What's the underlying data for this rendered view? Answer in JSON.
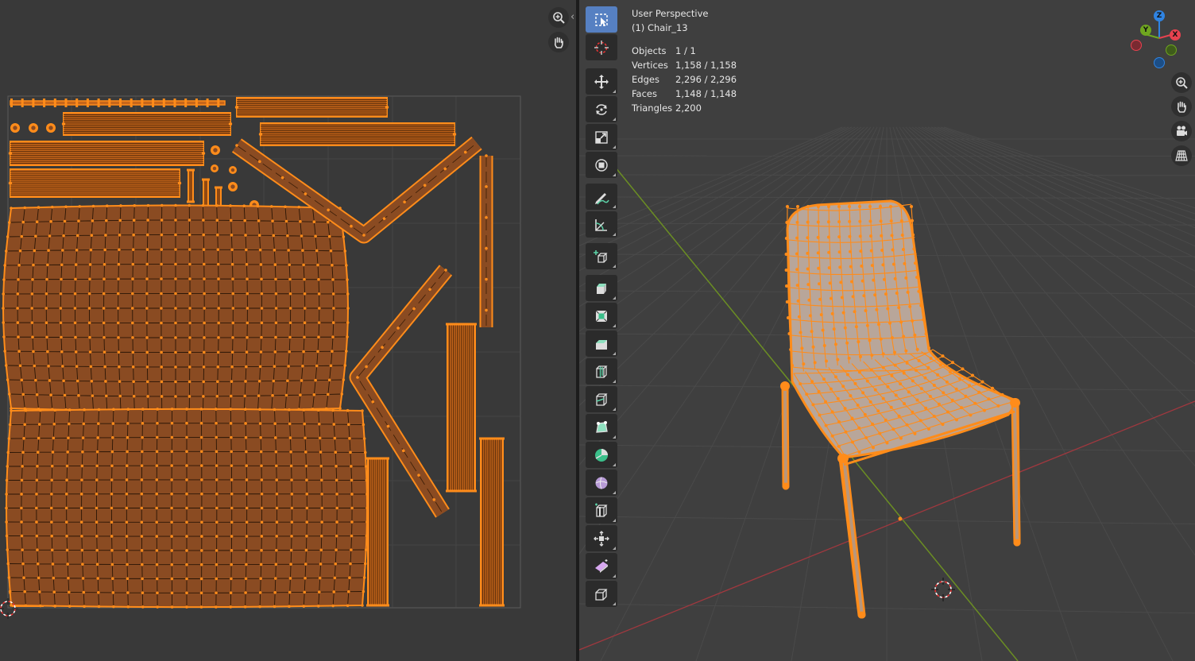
{
  "uv_editor": {
    "nav_buttons": [
      {
        "name": "zoom",
        "icon": "zoom-in-icon"
      },
      {
        "name": "pan",
        "icon": "hand-icon"
      }
    ],
    "collapse_glyph": "‹",
    "island_color": "#8a4b22",
    "edge_color": "#ff8c1a"
  },
  "viewport": {
    "header": {
      "view_name": "User Perspective",
      "object_name": "(1) Chair_13"
    },
    "stats": [
      {
        "label": "Objects",
        "value": "1 / 1"
      },
      {
        "label": "Vertices",
        "value": "1,158 / 1,158"
      },
      {
        "label": "Edges",
        "value": "2,296 / 2,296"
      },
      {
        "label": "Faces",
        "value": "1,148 / 1,148"
      },
      {
        "label": "Triangles",
        "value": "2,200"
      }
    ],
    "gizmo": {
      "x": "X",
      "y": "Y",
      "z": "Z",
      "x_color": "#e8424f",
      "y_color": "#6fa61f",
      "z_color": "#2f84e3"
    },
    "tools": [
      {
        "name": "select-box",
        "icon": "select-box-icon",
        "active": true
      },
      {
        "name": "cursor",
        "icon": "cursor-icon"
      },
      {
        "name": "move",
        "icon": "move-icon"
      },
      {
        "name": "rotate",
        "icon": "rotate-icon"
      },
      {
        "name": "scale",
        "icon": "scale-icon"
      },
      {
        "name": "transform",
        "icon": "transform-icon"
      },
      {
        "name": "annotate",
        "icon": "annotate-icon"
      },
      {
        "name": "measure",
        "icon": "measure-icon"
      },
      {
        "name": "add-cube",
        "icon": "add-cube-icon"
      },
      {
        "name": "extrude",
        "icon": "extrude-icon"
      },
      {
        "name": "inset",
        "icon": "inset-icon"
      },
      {
        "name": "bevel",
        "icon": "bevel-icon"
      },
      {
        "name": "loop-cut",
        "icon": "loop-cut-icon"
      },
      {
        "name": "knife",
        "icon": "knife-icon"
      },
      {
        "name": "poly-build",
        "icon": "poly-build-icon"
      },
      {
        "name": "spin",
        "icon": "spin-icon"
      },
      {
        "name": "smooth",
        "icon": "smooth-icon"
      },
      {
        "name": "edge-slide",
        "icon": "edge-slide-icon"
      },
      {
        "name": "shrink-fatten",
        "icon": "shrink-fatten-icon"
      },
      {
        "name": "shear",
        "icon": "shear-icon"
      },
      {
        "name": "rip",
        "icon": "rip-icon"
      }
    ],
    "nav_buttons": [
      {
        "name": "zoom",
        "icon": "zoom-in-icon"
      },
      {
        "name": "pan",
        "icon": "hand-icon"
      },
      {
        "name": "camera",
        "icon": "camera-icon"
      },
      {
        "name": "perspective",
        "icon": "grid-perspective-icon"
      }
    ],
    "mesh_color": "#ff8c1a",
    "surface_color": "#b8a69a"
  }
}
